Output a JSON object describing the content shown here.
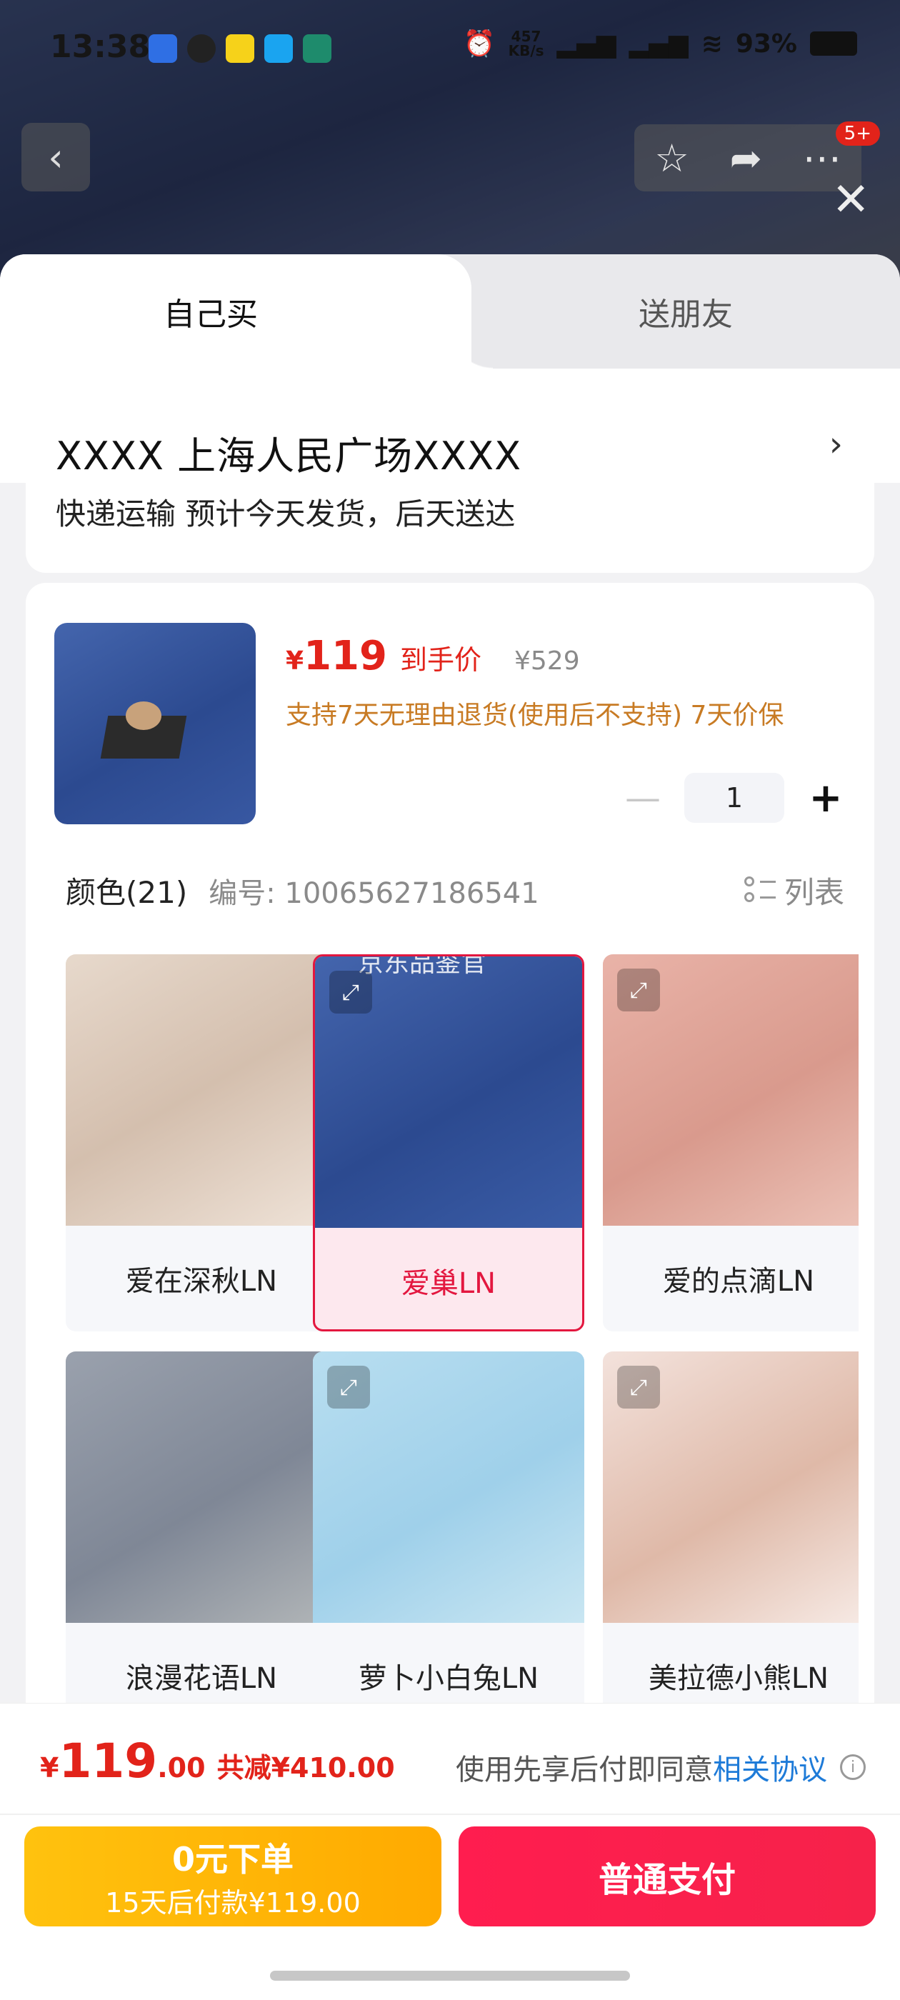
{
  "status_bar": {
    "time": "13:38",
    "net_speed_value": "457",
    "net_speed_unit": "KB/s",
    "battery": "93%"
  },
  "header": {
    "badge": "5+"
  },
  "tabs": [
    {
      "label": "自己买"
    },
    {
      "label": "送朋友"
    }
  ],
  "address": {
    "title": "XXXX  上海人民广场XXXX",
    "delivery": "快递运输 预计今天发货，后天送达"
  },
  "product": {
    "currency": "¥",
    "price": "119",
    "price_tag": "到手价",
    "original_price": "¥529",
    "promise": "支持7天无理由退货(使用后不支持)  7天价保",
    "quantity": "1"
  },
  "variants": {
    "title": "颜色(21)",
    "code": "编号: 10065627186541",
    "view_toggle": "列表",
    "watermark": "京东品鉴官",
    "items": [
      {
        "label": "爱在深秋LN",
        "selected": false
      },
      {
        "label": "爱巢LN",
        "selected": true
      },
      {
        "label": "爱的点滴LN",
        "selected": false
      },
      {
        "label": "浪漫花语LN",
        "selected": false
      },
      {
        "label": "萝卜小白兔LN",
        "selected": false
      },
      {
        "label": "美拉德小熊LN",
        "selected": false
      }
    ]
  },
  "footer": {
    "total_symbol": "¥",
    "total_int": "119",
    "total_dec": ".00",
    "saving": "共减¥410.00",
    "agreement_prefix": "使用先享后付即同意",
    "agreement_link": "相关协议",
    "bnpl_line1": "0元下单",
    "bnpl_line2": "15天后付款¥119.00",
    "pay_label": "普通支付"
  },
  "colors": {
    "accent_red": "#e2231a",
    "selected_border": "#e3173f",
    "link_blue": "#1e7bd8",
    "promise_orange": "#c87b24"
  }
}
